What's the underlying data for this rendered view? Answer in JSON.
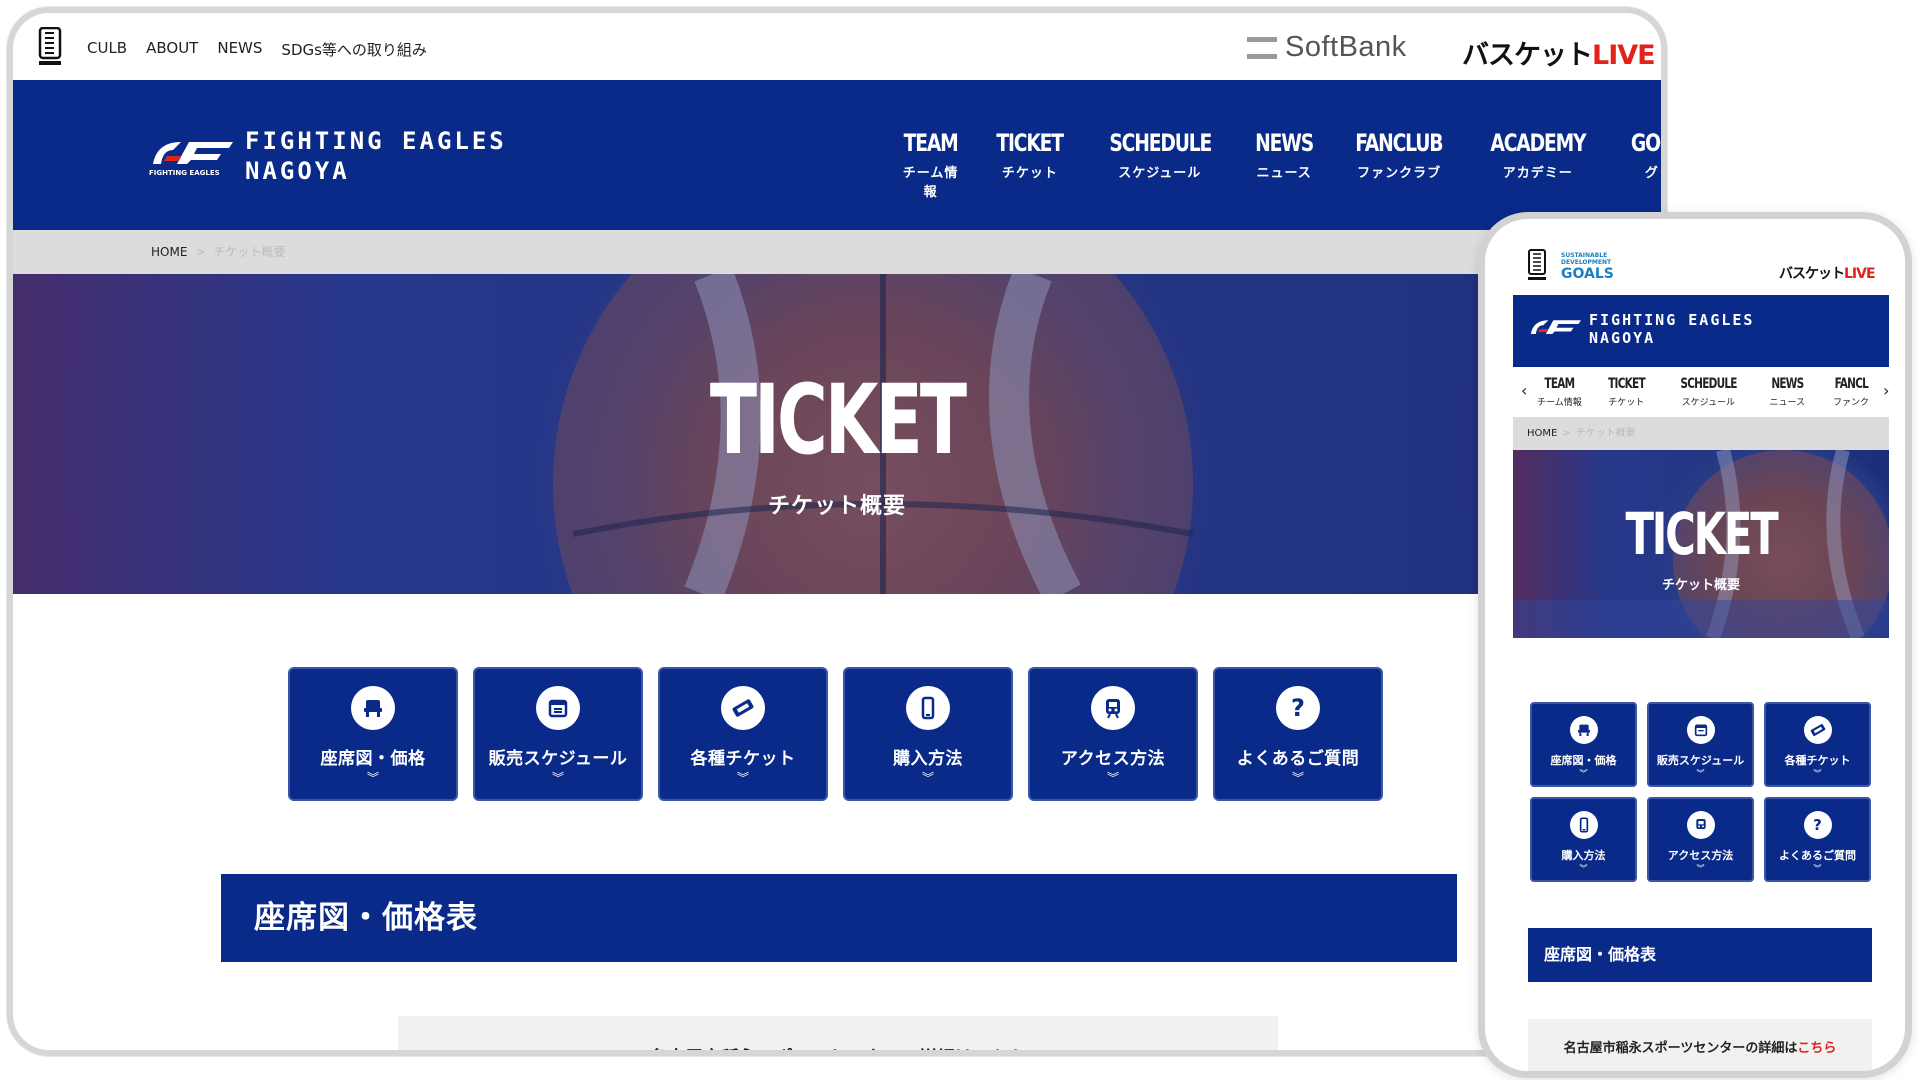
{
  "desktop": {
    "top_links": [
      "CULB",
      "ABOUT",
      "NEWS",
      "SDGs等への取り組み"
    ],
    "sponsor": "SoftBank",
    "basket_live": {
      "main": "バスケット",
      "accent": "LIVE"
    },
    "logo": {
      "line1": "FIGHTING EAGLES",
      "line2": "NAGOYA",
      "small": "FIGHTING EAGLES"
    },
    "nav": [
      {
        "en": "TEAM",
        "jp": "チーム情報"
      },
      {
        "en": "TICKET",
        "jp": "チケット"
      },
      {
        "en": "SCHEDULE",
        "jp": "スケジュール"
      },
      {
        "en": "NEWS",
        "jp": "ニュース"
      },
      {
        "en": "FANCLUB",
        "jp": "ファンクラブ"
      },
      {
        "en": "ACADEMY",
        "jp": "アカデミー"
      },
      {
        "en": "GOODS",
        "jp": "グッズ"
      }
    ],
    "breadcrumb": {
      "home": "HOME",
      "sep": ">",
      "current": "チケット概要"
    },
    "hero": {
      "title": "TICKET",
      "subtitle": "チケット概要"
    },
    "cards": [
      {
        "label": "座席図・価格",
        "icon": "seat-icon"
      },
      {
        "label": "販売スケジュール",
        "icon": "calendar-icon"
      },
      {
        "label": "各種チケット",
        "icon": "ticket-icon"
      },
      {
        "label": "購入方法",
        "icon": "smartphone-icon"
      },
      {
        "label": "アクセス方法",
        "icon": "train-icon"
      },
      {
        "label": "よくあるご質問",
        "icon": "question-icon"
      }
    ],
    "chevron": "︾",
    "section_title": "座席図・価格表",
    "info": {
      "text": "名古屋市稲永スポーツセンターの詳細は",
      "link": "こちら"
    }
  },
  "phone": {
    "sdgs": {
      "line1": "SUSTAINABLE",
      "line2": "DEVELOPMENT",
      "goals": "GOALS"
    },
    "basket_live": {
      "main": "バスケット",
      "accent": "LIVE"
    },
    "logo": {
      "line1": "FIGHTING EAGLES",
      "line2": "NAGOYA"
    },
    "nav": [
      {
        "en": "TEAM",
        "jp": "チーム情報"
      },
      {
        "en": "TICKET",
        "jp": "チケット"
      },
      {
        "en": "SCHEDULE",
        "jp": "スケジュール"
      },
      {
        "en": "NEWS",
        "jp": "ニュース"
      },
      {
        "en": "FANCL",
        "jp": "ファンク"
      }
    ],
    "nav_prev": "‹",
    "nav_next": "›",
    "breadcrumb": {
      "home": "HOME",
      "sep": ">",
      "current": "チケット概要"
    },
    "hero": {
      "title": "TICKET",
      "subtitle": "チケット概要"
    },
    "cards": [
      {
        "label": "座席図・価格",
        "icon": "seat-icon"
      },
      {
        "label": "販売スケジュール",
        "icon": "calendar-icon"
      },
      {
        "label": "各種チケット",
        "icon": "ticket-icon"
      },
      {
        "label": "購入方法",
        "icon": "smartphone-icon"
      },
      {
        "label": "アクセス方法",
        "icon": "train-icon"
      },
      {
        "label": "よくあるご質問",
        "icon": "question-icon"
      }
    ],
    "section_title": "座席図・価格表",
    "info": {
      "text": "名古屋市稲永スポーツセンターの詳細は",
      "link": "こちら"
    }
  },
  "colors": {
    "brand_navy": "#0a2a8a",
    "accent_red": "#e2231a",
    "breadcrumb_bg": "#dcdcdc"
  }
}
